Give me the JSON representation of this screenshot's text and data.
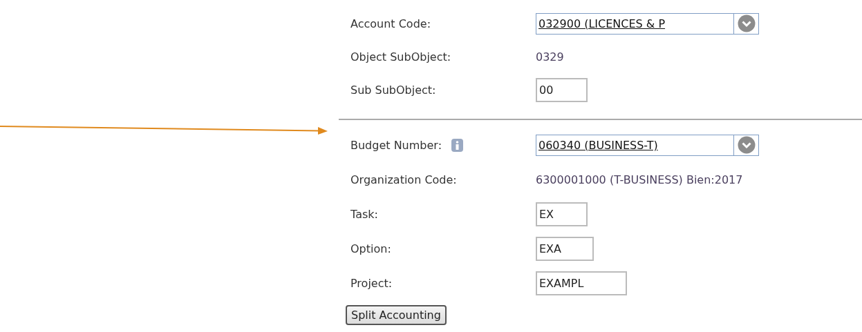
{
  "sections": [
    {
      "fields": [
        {
          "label": "Account Code:",
          "kind": "select",
          "value": "032900 (LICENCES & P",
          "info": false
        },
        {
          "label": "Object SubObject:",
          "kind": "text",
          "value": "0329",
          "info": false
        },
        {
          "label": "Sub SubObject:",
          "kind": "input",
          "value": "00",
          "info": false
        }
      ]
    },
    {
      "fields": [
        {
          "label": "Budget Number:",
          "kind": "select",
          "value": "060340 (BUSINESS-T)",
          "info": true
        },
        {
          "label": "Organization Code:",
          "kind": "text",
          "value": "6300001000 (T-BUSINESS) Bien:2017",
          "info": false
        },
        {
          "label": "Task:",
          "kind": "input",
          "value": "EX",
          "info": false
        },
        {
          "label": "Option:",
          "kind": "input",
          "value": "EXA",
          "info": false
        },
        {
          "label": "Project:",
          "kind": "input",
          "value": "EXAMPL",
          "info": false
        }
      ]
    }
  ],
  "button": "Split Accounting"
}
